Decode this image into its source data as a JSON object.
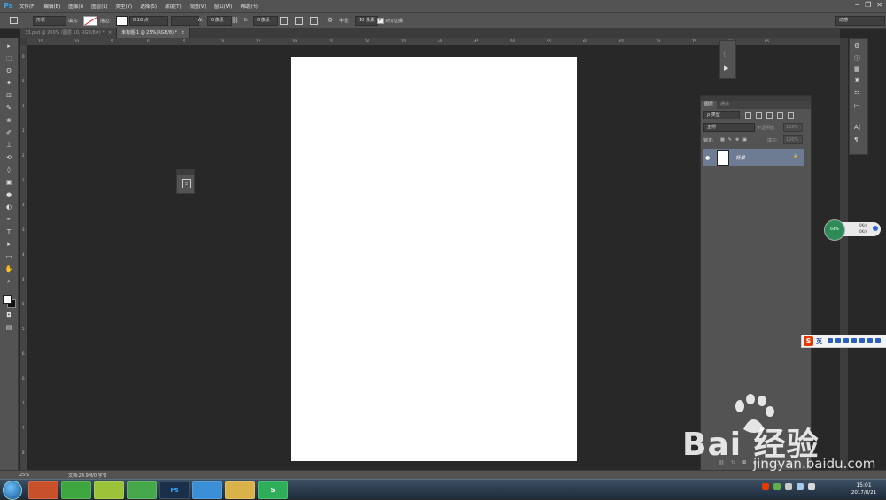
{
  "app": {
    "logo": "Ps"
  },
  "menu": [
    "文件(F)",
    "编辑(E)",
    "图像(I)",
    "图层(L)",
    "类型(Y)",
    "选择(S)",
    "滤镜(T)",
    "视图(V)",
    "窗口(W)",
    "帮助(H)"
  ],
  "window_controls": {
    "minimize": "─",
    "restore": "❐",
    "close": "✕"
  },
  "options": {
    "mode": "形状",
    "fill_label": "填充:",
    "stroke_label": "描边:",
    "stroke_width": "0.16 点",
    "w_label": "W:",
    "w_value": "0 像素",
    "h_label": "H:",
    "h_value": "0 像素",
    "radius_label": "半径:",
    "radius_value": "10 像素",
    "align_edges": "对齐边缘",
    "workspace": "动感"
  },
  "tabs": [
    {
      "label": "33.psd @ 200% (图层 10, RGB/8#) *",
      "active": false
    },
    {
      "label": "未标题-1 @ 25%(RGB/8) *",
      "active": true
    }
  ],
  "ruler_top": [
    "15",
    "10",
    "5",
    "0",
    "5",
    "10",
    "15",
    "20",
    "25",
    "30",
    "35",
    "40",
    "45",
    "50",
    "55",
    "60",
    "65",
    "70",
    "75",
    "80",
    "85"
  ],
  "ruler_left": [
    "0",
    "5",
    "1",
    "1",
    "2",
    "2",
    "3",
    "3",
    "4",
    "4",
    "5",
    "5",
    "6",
    "6",
    "7",
    "7",
    "8"
  ],
  "tools": [
    "▸",
    "⬚",
    "ʘ",
    "✦",
    "⊡",
    "✎",
    "⊗",
    "✐",
    "⊥",
    "⟲",
    "◊",
    "▣",
    "●",
    "◐",
    "✒",
    "T",
    "▸",
    "▭",
    "✋",
    "⌕"
  ],
  "layers_panel": {
    "tabs": [
      {
        "label": "图层",
        "active": true
      },
      {
        "label": "通道",
        "active": false
      }
    ],
    "filter": "ρ 类型",
    "blend_mode": "正常",
    "opacity_label": "不透明度:",
    "opacity_value": "100%",
    "lock_label": "锁定:",
    "fill_label": "填充:",
    "fill_value": "100%",
    "layer_name": "背景",
    "eye": "●",
    "lock": "🔒"
  },
  "mini_panel": {
    "icon_label": "⌗"
  },
  "float_strip": [
    "⦙",
    "▶"
  ],
  "side_dock": [
    "⚙",
    "ⓘ",
    "▦",
    "♜",
    "⚏",
    "⊢",
    "A|",
    "¶",
    "◐"
  ],
  "net_widget": {
    "percent": "64%",
    "up": "0K/s",
    "down": "0K/s"
  },
  "ime": {
    "logo": "S",
    "lang": "英"
  },
  "status": {
    "zoom": "25%",
    "doc": "文档:24.9M/0 字节"
  },
  "taskbar": {
    "apps": [
      "",
      "",
      "",
      "",
      "Ps",
      "",
      "",
      "S"
    ]
  },
  "clock": {
    "time": "15:01",
    "date": "2017/8/21"
  },
  "watermark": {
    "text": "Bai  经验",
    "sub": "jingyan.baidu.com"
  }
}
